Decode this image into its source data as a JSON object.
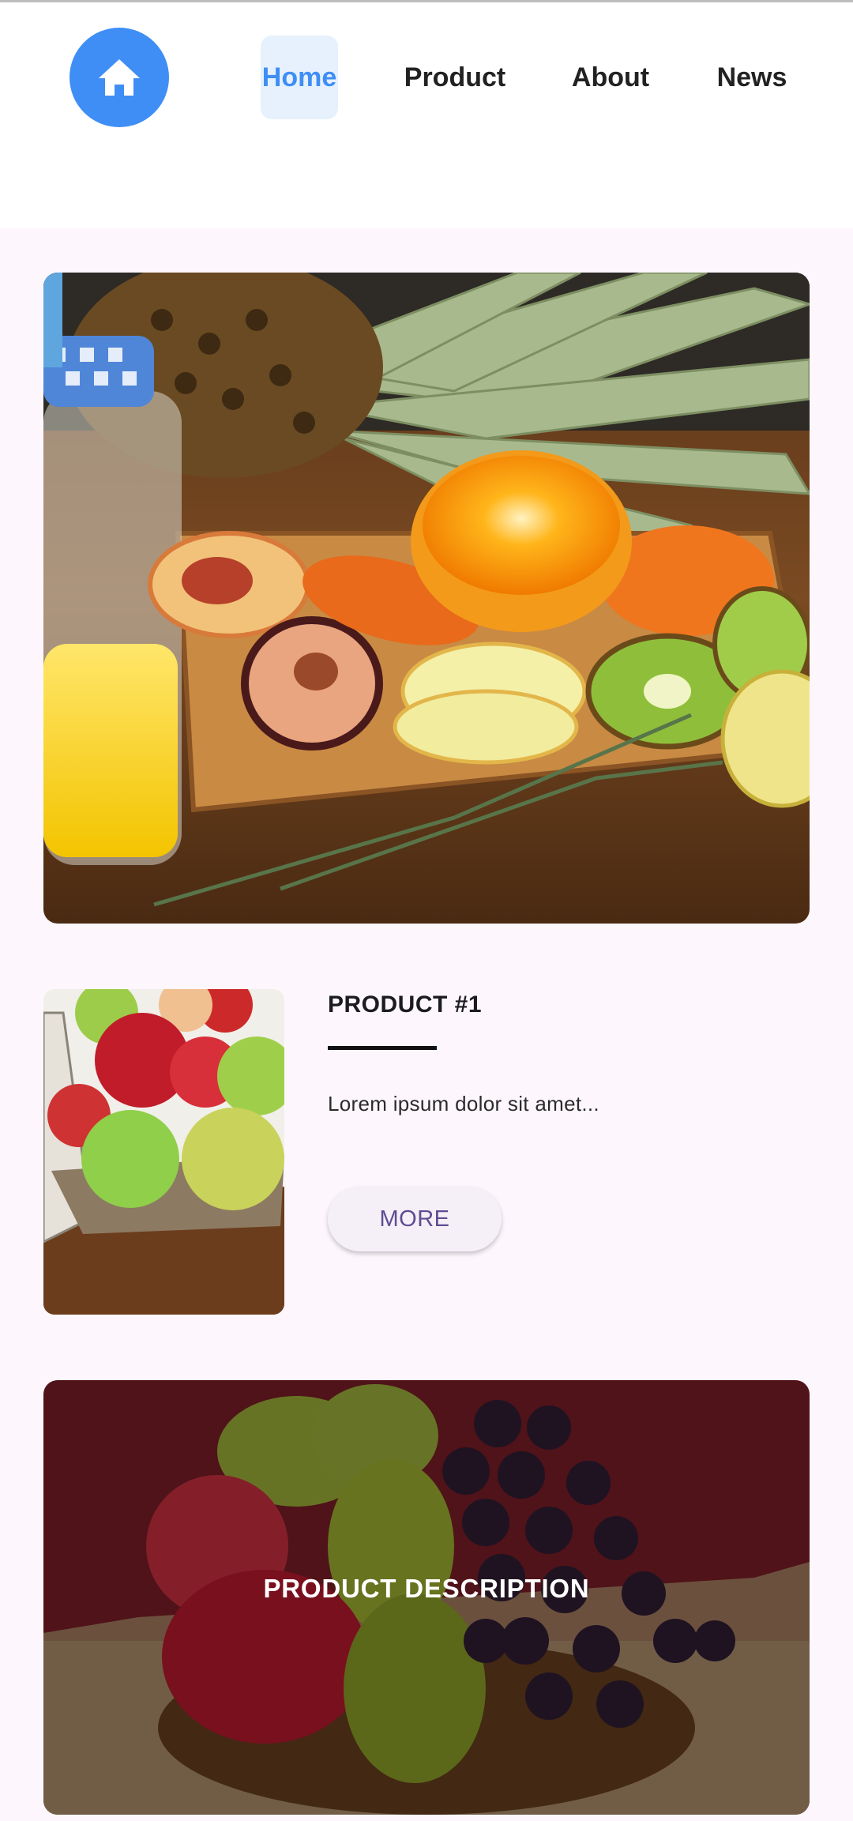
{
  "header": {
    "logo_icon": "home-icon",
    "nav": [
      {
        "label": "Home",
        "active": true
      },
      {
        "label": "Product",
        "active": false
      },
      {
        "label": "About",
        "active": false
      },
      {
        "label": "News",
        "active": false
      }
    ]
  },
  "hero": {
    "image": "fruit-and-juice-photo"
  },
  "product": {
    "image": "apples-basket-photo",
    "title": "PRODUCT #1",
    "description": "Lorem ipsum dolor sit amet...",
    "more_label": "MORE"
  },
  "feature": {
    "image": "fruit-basket-photo",
    "label": "PRODUCT DESCRIPTION"
  },
  "colors": {
    "accent": "#3f8ef5",
    "page_bg": "#fdf7fd",
    "button_text": "#5f4b92"
  }
}
